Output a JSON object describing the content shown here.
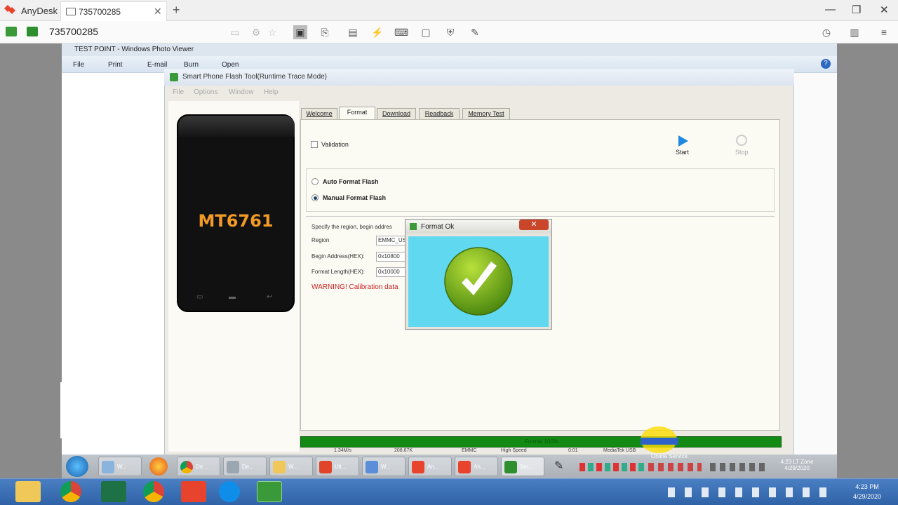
{
  "anydesk": {
    "brand": "AnyDesk",
    "tab_label": "735700285",
    "tab_close": "✕",
    "new_tab": "+",
    "address": "735700285",
    "window_controls": {
      "minimize": "—",
      "maximize": "❐",
      "close": "✕"
    }
  },
  "photo_viewer": {
    "title": "TEST POINT - Windows Photo Viewer",
    "menu": [
      "File",
      "Print",
      "E-mail",
      "Burn",
      "Open"
    ]
  },
  "flash_tool": {
    "title": "Smart Phone Flash Tool(Runtime Trace Mode)",
    "menu": [
      "File",
      "Options",
      "Window",
      "Help"
    ],
    "phone_model": "MT6761",
    "tabs": [
      "Welcome",
      "Format",
      "Download",
      "Readback",
      "Memory Test"
    ],
    "active_tab": "Format",
    "validation_label": "Validation",
    "start_label": "Start",
    "stop_label": "Stop",
    "format_options": {
      "auto": "Auto Format Flash",
      "manual": "Manual Format Flash",
      "selected": "manual"
    },
    "region_hint": "Specify the region, begin addres",
    "region_label": "Region",
    "region_value": "EMMC_US",
    "begin_label": "Begin Address(HEX):",
    "begin_value": "0x10800",
    "length_label": "Format Length(HEX):",
    "length_value": "0x10000",
    "warning": "WARNING! Calibration data",
    "status_text": "Format 100%",
    "status_fields": [
      "1.34M/s",
      "208.67K",
      "EMMC",
      "High Speed",
      "0:01",
      "MediaTek USB"
    ]
  },
  "dialog": {
    "title": "Format Ok",
    "close": "✕",
    "bg_color": "#5fd8f0",
    "icon": "checkmark-icon"
  },
  "remote_taskbar": {
    "items": [
      "W...",
      "De...",
      "De...",
      "W...",
      "Ult...",
      "W...",
      "An...",
      "An...",
      "Sm..."
    ],
    "tray": {
      "time": "4:23 LT Zone",
      "date": "4/29/2020"
    },
    "popup": "Online Service"
  },
  "local_taskbar": {
    "time": "4:23 PM",
    "date": "4/29/2020"
  },
  "colors": {
    "anydesk_red": "#e8432c",
    "status_green": "#138a13",
    "model_orange": "#f19a25",
    "taskbar_blue": "#3a6db3"
  }
}
